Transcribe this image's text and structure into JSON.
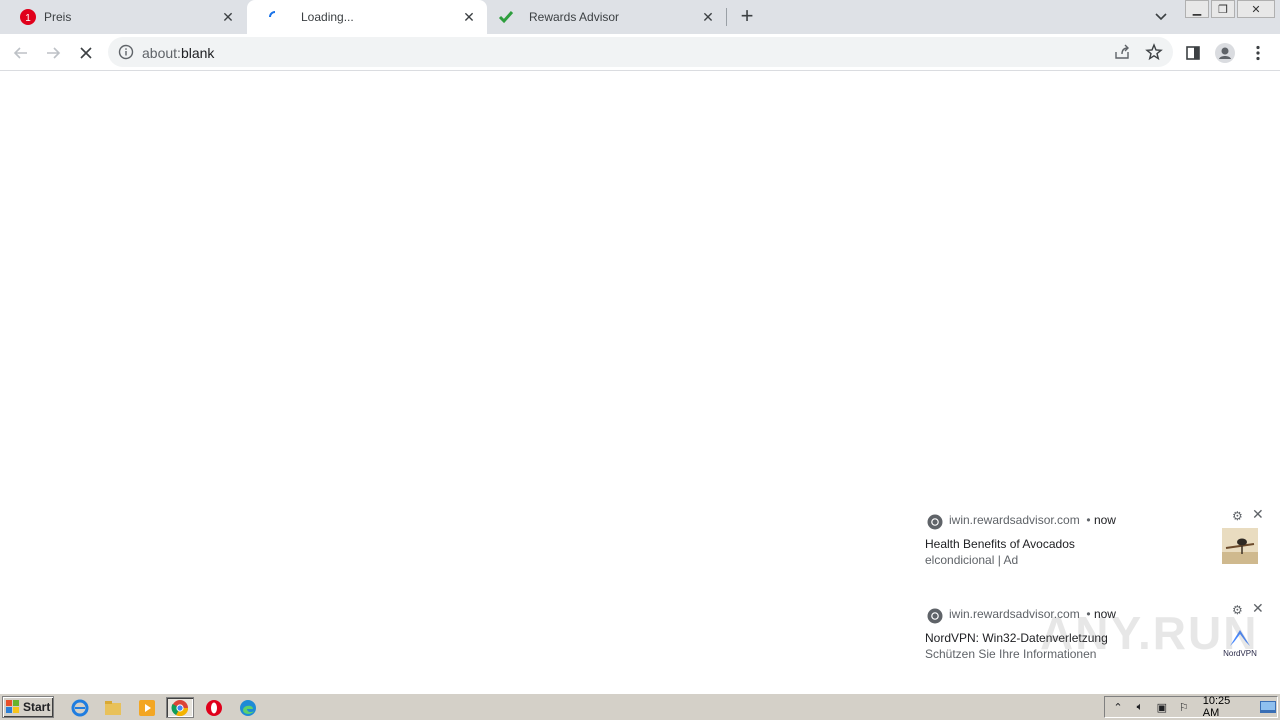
{
  "tabs": [
    {
      "label": "Preis",
      "favicon": "opera-badge-icon",
      "active": false
    },
    {
      "label": "Loading...",
      "favicon": "loading-spinner-icon",
      "active": true
    },
    {
      "label": "Rewards Advisor",
      "favicon": "green-check-icon",
      "active": false
    }
  ],
  "opera_badge_text": "1",
  "address": {
    "scheme": "about:",
    "rest": "blank"
  },
  "notifications": [
    {
      "source": "iwin.rewardsadvisor.com",
      "separator": "•",
      "time": "now",
      "title": "Health Benefits of Avocados",
      "body": "elcondicional | Ad",
      "thumb": "bird-on-branch-image"
    },
    {
      "source": "iwin.rewardsadvisor.com",
      "separator": "•",
      "time": "now",
      "title": "NordVPN: Win32-Datenverletzung",
      "body": "Schützen Sie Ihre Informationen",
      "thumb": "nordvpn-logo",
      "thumb_label": "NordVPN"
    }
  ],
  "watermark": "ANY.RUN",
  "taskbar": {
    "start_label": "Start",
    "apps": [
      "ie-icon",
      "explorer-folder-icon",
      "media-player-icon",
      "chrome-icon",
      "opera-icon",
      "edge-icon"
    ],
    "clock": "10:25 AM"
  },
  "colors": {
    "tabstrip": "#dee1e6",
    "omnibox": "#f1f3f4",
    "opera_red": "#e0001b",
    "taskbar": "#d4d0c8"
  }
}
